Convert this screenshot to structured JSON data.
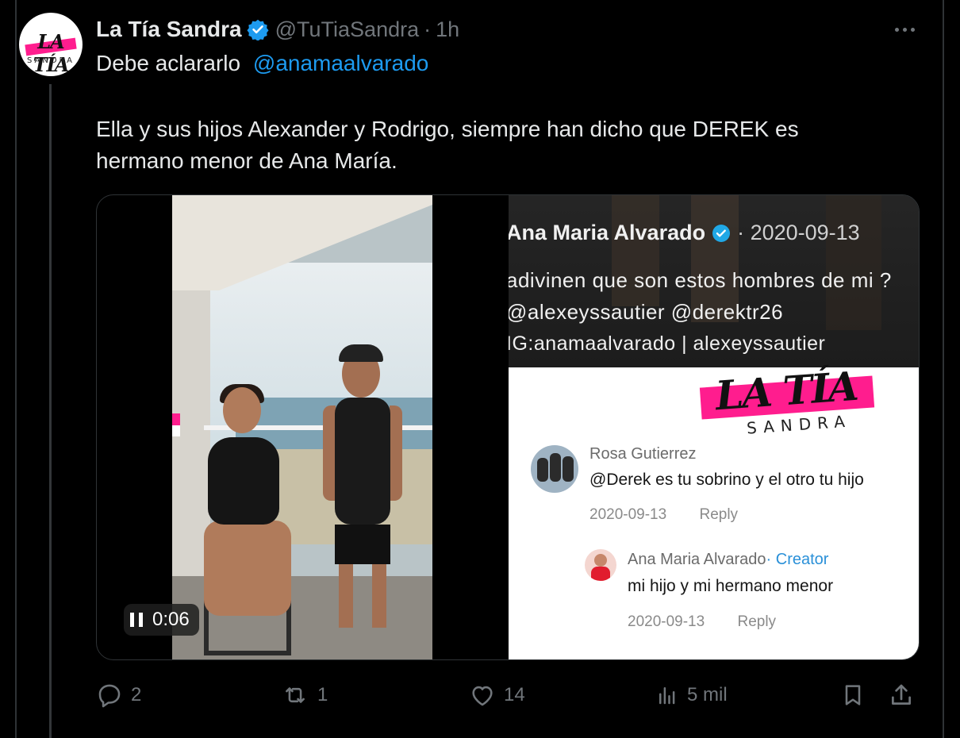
{
  "tweet": {
    "author_name": "La Tía Sandra",
    "handle": "@TuTiaSandra",
    "separator": "·",
    "time": "1h",
    "avatar_text_top": "LA TÍA",
    "avatar_text_bottom": "SANDRA",
    "line1": "Debe aclararlo",
    "mention": "@anamaalvarado",
    "body": "Ella y sus hijos Alexander y Rodrigo, siempre han dicho que DEREK es hermano menor de Ana María."
  },
  "video": {
    "time": "0:06",
    "screenshot": {
      "author": "Ana Maria Alvarado",
      "date": "· 2020-09-13",
      "text": "adivinen que son estos hombres de mi ?",
      "tags": "@alexeyssautier  @derektr26",
      "ig": "IG:anamaalvarado | alexeyssautier",
      "watermark_top": "LA TÍA",
      "watermark_bottom": "SANDRA",
      "comments": [
        {
          "name": "Rosa Gutierrez",
          "text": "@Derek es tu sobrino y el otro tu hijo",
          "date": "2020-09-13",
          "reply": "Reply"
        },
        {
          "name": "Ana Maria Alvarado",
          "badge": "· Creator",
          "text": "mi hijo y mi hermano menor",
          "date": "2020-09-13",
          "reply": "Reply"
        }
      ]
    }
  },
  "actions": {
    "replies": "2",
    "reposts": "1",
    "likes": "14",
    "views": "5 mil"
  },
  "colors": {
    "background": "#000000",
    "text": "#e7e9ea",
    "muted": "#71767b",
    "accent": "#1d9bf0",
    "brand_pink": "#ff1d8e"
  }
}
